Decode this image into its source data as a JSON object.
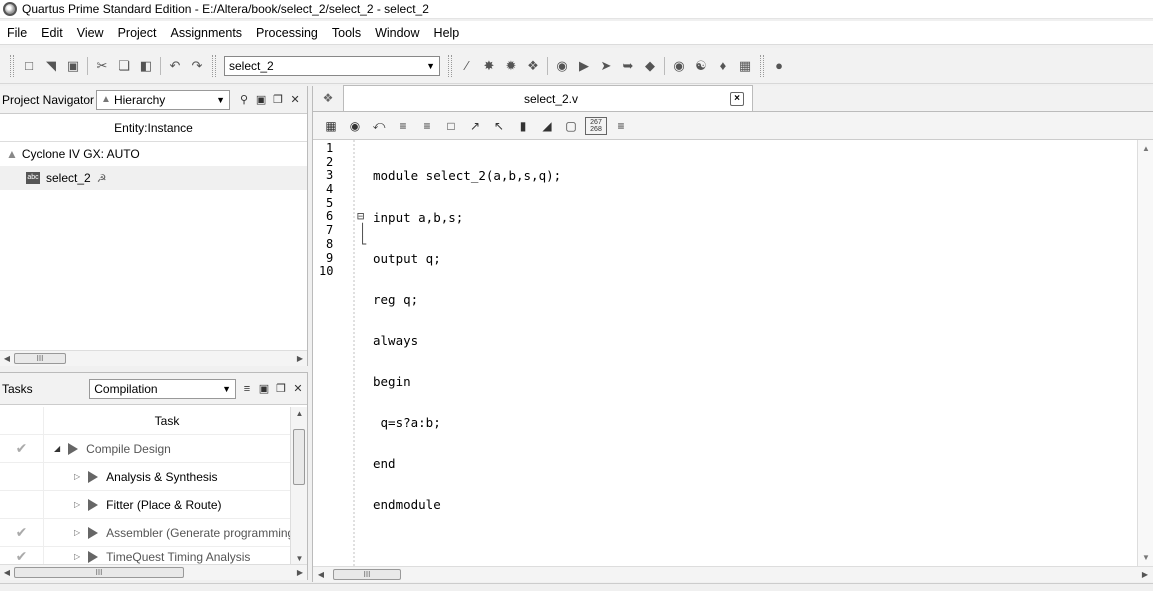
{
  "window": {
    "title": "Quartus Prime Standard Edition - E:/Altera/book/select_2/select_2 - select_2"
  },
  "menu": [
    "File",
    "Edit",
    "View",
    "Project",
    "Assignments",
    "Processing",
    "Tools",
    "Window",
    "Help"
  ],
  "toolbar": {
    "entity_selector": "select_2"
  },
  "navigator": {
    "label": "Project Navigator",
    "view": "Hierarchy",
    "column_header": "Entity:Instance",
    "items": [
      "Cyclone IV GX: AUTO",
      "select_2"
    ]
  },
  "tasks": {
    "label": "Tasks",
    "flow": "Compilation",
    "column_header": "Task",
    "rows": [
      {
        "name": "Compile Design",
        "done": true
      },
      {
        "name": "Analysis & Synthesis",
        "done": false
      },
      {
        "name": "Fitter (Place & Route)",
        "done": false
      },
      {
        "name": "Assembler (Generate programming files)",
        "done": true
      },
      {
        "name": "TimeQuest Timing Analysis",
        "done": true
      }
    ]
  },
  "editor": {
    "tab_title": "select_2.v",
    "line_numbers": [
      "1",
      "2",
      "3",
      "4",
      "5",
      "6",
      "7",
      "8",
      "9",
      "10"
    ],
    "lines": [
      "module select_2(a,b,s,q);",
      "input a,b,s;",
      "output q;",
      "reg q;",
      "always",
      "begin",
      " q=s?a:b;",
      "end",
      "endmodule",
      ""
    ],
    "line_col_badge": "267 268"
  },
  "scroll_labels": {
    "thumb": "III"
  }
}
